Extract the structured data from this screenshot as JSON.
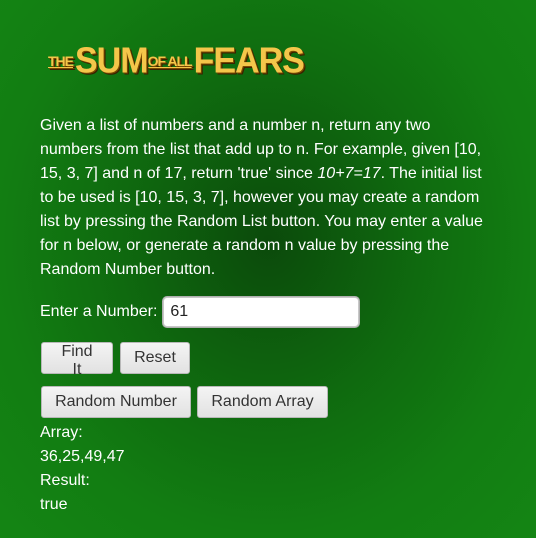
{
  "logo": {
    "the": "THE",
    "sum": "SUM",
    "of_all": "OF ALL",
    "fears": "FEARS"
  },
  "description": {
    "part1": "Given a list of numbers and a number n, return any two numbers from the list that add up to n. For example, given [10, 15, 3, 7] and n of 17, return 'true' since ",
    "equation": "10+7=17",
    "part2": ". The initial list to be used is [10, 15, 3, 7], however you may create a random list by pressing the Random List button. You may enter a value for n below, or generate a random n value by pressing the Random Number button."
  },
  "input": {
    "label": "Enter a Number:",
    "value": "61"
  },
  "buttons": {
    "find": "Find It",
    "reset": "Reset",
    "random_number": "Random Number",
    "random_array": "Random Array"
  },
  "output": {
    "array_label": "Array:",
    "array_value": "36,25,49,47",
    "result_label": "Result:",
    "result_value": "true"
  }
}
